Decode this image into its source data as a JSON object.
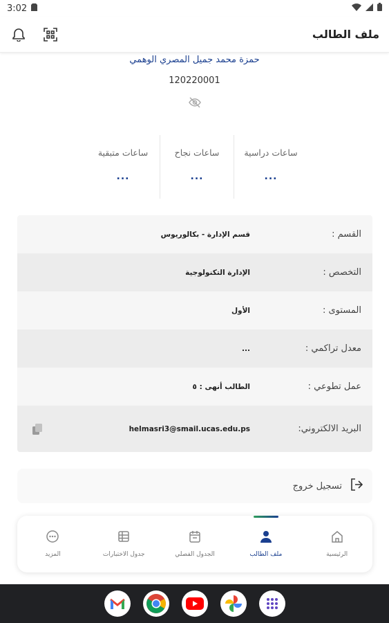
{
  "status_bar": {
    "time": "3:02"
  },
  "app_bar": {
    "title": "ملف الطالب"
  },
  "profile": {
    "name": "حمزة محمد جميل المصري الوهمي",
    "student_id": "120220001"
  },
  "stats": [
    {
      "label": "ساعات دراسية",
      "value": "..."
    },
    {
      "label": "ساعات نجاح",
      "value": "..."
    },
    {
      "label": "ساعات متبقية",
      "value": "..."
    }
  ],
  "info": [
    {
      "label": "القسم :",
      "value": "قسم الإدارة - بكالوريوس"
    },
    {
      "label": "التخصص :",
      "value": "الإدارة التكنولوجية"
    },
    {
      "label": "المستوى :",
      "value": "الأول"
    },
    {
      "label": "معدل تراكمي :",
      "value": "..."
    },
    {
      "label": "عمل تطوعي :",
      "value": "الطالب أنهى : ٥"
    },
    {
      "label": "البريد الالكتروني:",
      "value": "helmasri3@smail.ucas.edu.ps"
    }
  ],
  "logout": {
    "label": "تسجيل خروج"
  },
  "bottom_nav": [
    {
      "label": "الرئيسية",
      "icon": "home-icon",
      "active": false
    },
    {
      "label": "ملف الطالب",
      "icon": "person-icon",
      "active": true
    },
    {
      "label": "الجدول الفصلي",
      "icon": "calendar-icon",
      "active": false
    },
    {
      "label": "جدول الاختبارات",
      "icon": "table-icon",
      "active": false
    },
    {
      "label": "المزيد",
      "icon": "more-icon",
      "active": false
    }
  ],
  "dock": [
    "gmail-icon",
    "chrome-icon",
    "youtube-icon",
    "photos-icon",
    "apps-icon"
  ],
  "colors": {
    "accent": "#1a3f8f",
    "green": "#2e9e5b",
    "dock_bg": "#202124"
  }
}
